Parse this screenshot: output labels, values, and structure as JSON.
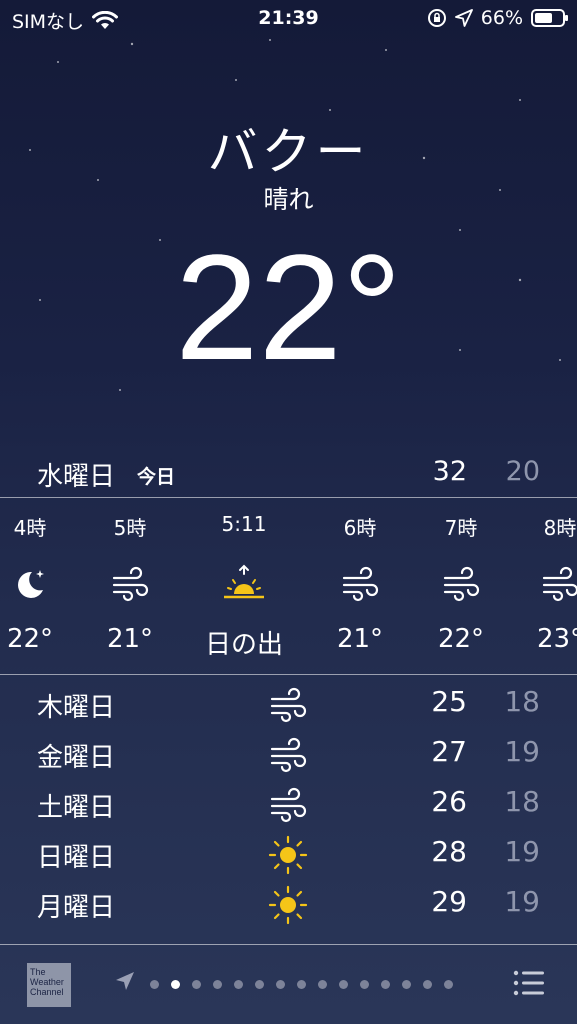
{
  "status_bar": {
    "carrier": "SIMなし",
    "time": "21:39",
    "battery_percent": "66%",
    "battery_level": 0.66
  },
  "location": {
    "city": "バクー",
    "condition": "晴れ",
    "temperature": "22°"
  },
  "today": {
    "day": "水曜日",
    "label": "今日",
    "high": "32",
    "low": "20"
  },
  "hourly": [
    {
      "time": "4時",
      "icon": "moon-icon",
      "temp": "22°"
    },
    {
      "time": "5時",
      "icon": "wind-icon",
      "temp": "21°"
    },
    {
      "time": "5:11",
      "icon": "sunrise-icon",
      "temp": "日の出"
    },
    {
      "time": "6時",
      "icon": "wind-icon",
      "temp": "21°"
    },
    {
      "time": "7時",
      "icon": "wind-icon",
      "temp": "22°"
    },
    {
      "time": "8時",
      "icon": "wind-icon",
      "temp": "23°"
    }
  ],
  "daily": [
    {
      "day": "木曜日",
      "icon": "wind-icon",
      "high": "25",
      "low": "18"
    },
    {
      "day": "金曜日",
      "icon": "wind-icon",
      "high": "27",
      "low": "19"
    },
    {
      "day": "土曜日",
      "icon": "wind-icon",
      "high": "26",
      "low": "18"
    },
    {
      "day": "日曜日",
      "icon": "sun-icon",
      "high": "28",
      "low": "19"
    },
    {
      "day": "月曜日",
      "icon": "sun-icon",
      "high": "29",
      "low": "19"
    }
  ],
  "bottom_bar": {
    "logo_text": "The Weather Channel",
    "page_count": 15,
    "active_page": 1
  },
  "colors": {
    "sun": "#f5c518",
    "low_temp": "#8f96ad"
  }
}
